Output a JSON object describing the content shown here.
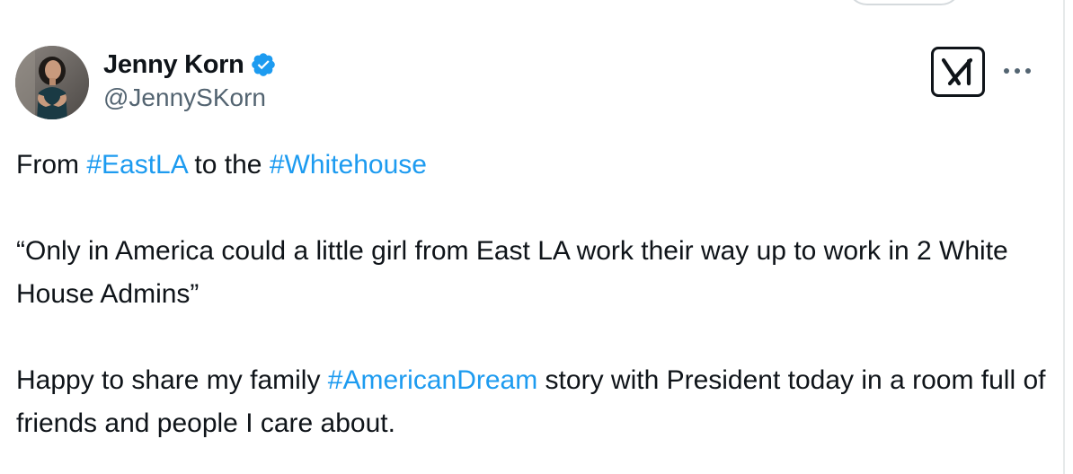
{
  "author": {
    "display_name": "Jenny Korn",
    "handle": "@JennySKorn",
    "verified": true,
    "avatar_icon": "profile-photo"
  },
  "header": {
    "grok_icon": "grok-logo-icon",
    "more_icon": "more-dots-icon"
  },
  "tweet": {
    "line1": {
      "t1": "From ",
      "h1": "#EastLA",
      "t2": " to the ",
      "h2": "#Whitehouse"
    },
    "quote": "“Only in America could a little girl from East LA work their way up to work in 2 White House Admins”",
    "para3": {
      "t1": "Happy to share my family ",
      "h1": "#AmericanDream",
      "t2": " story with President today in a room full of friends and people I care about."
    }
  },
  "colors": {
    "hashtag": "#1d9bf0",
    "verified_badge": "#1d9bf0",
    "text": "#0f1419",
    "secondary_text": "#536471"
  }
}
